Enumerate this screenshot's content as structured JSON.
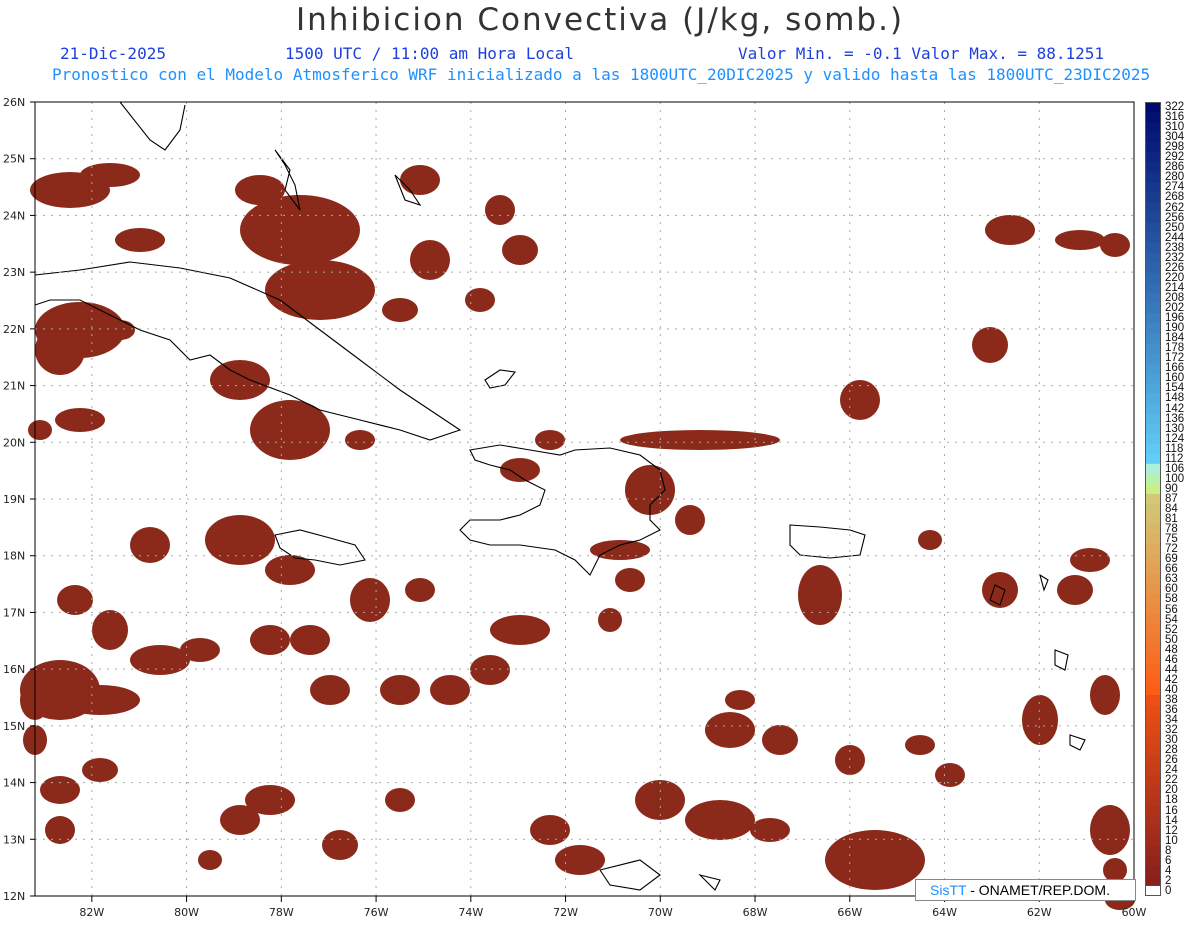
{
  "header": {
    "title": "Inhibicion Convectiva (J/kg, somb.)",
    "date": "21-Dic-2025",
    "time": "1500 UTC / 11:00 am Hora Local",
    "minmax": "Valor Min. = -0.1  Valor Max. = 88.1251",
    "model_info": "Pronostico con el Modelo Atmosferico WRF inicializado a las 1800UTC_20DIC2025 y valido hasta las  1800UTC_23DIC2025"
  },
  "map": {
    "lat_labels": [
      "26N",
      "25N",
      "24N",
      "23N",
      "22N",
      "21N",
      "20N",
      "19N",
      "18N",
      "17N",
      "16N",
      "15N",
      "14N",
      "13N",
      "12N"
    ],
    "lon_labels": [
      "82W",
      "80W",
      "78W",
      "76W",
      "74W",
      "72W",
      "70W",
      "68W",
      "66W",
      "64W",
      "62W",
      "60W"
    ],
    "lat_range": [
      12,
      26
    ],
    "lon_range": [
      -83.2,
      -60
    ],
    "grid": true,
    "fill_color": "#8b2a1a"
  },
  "legend": {
    "labels": [
      "322",
      "316",
      "310",
      "304",
      "298",
      "292",
      "286",
      "280",
      "274",
      "268",
      "262",
      "256",
      "250",
      "244",
      "238",
      "232",
      "226",
      "220",
      "214",
      "208",
      "202",
      "196",
      "190",
      "184",
      "178",
      "172",
      "166",
      "160",
      "154",
      "148",
      "142",
      "136",
      "130",
      "124",
      "118",
      "112",
      "106",
      "100",
      "90",
      "87",
      "84",
      "81",
      "78",
      "75",
      "72",
      "69",
      "66",
      "63",
      "60",
      "58",
      "56",
      "54",
      "52",
      "50",
      "48",
      "46",
      "44",
      "42",
      "40",
      "38",
      "36",
      "34",
      "32",
      "30",
      "28",
      "26",
      "24",
      "22",
      "20",
      "18",
      "16",
      "14",
      "12",
      "10",
      "8",
      "6",
      "4",
      "2",
      "0"
    ]
  },
  "credit": {
    "brand": "SisTT",
    "text": "- ONAMET/REP.DOM."
  }
}
